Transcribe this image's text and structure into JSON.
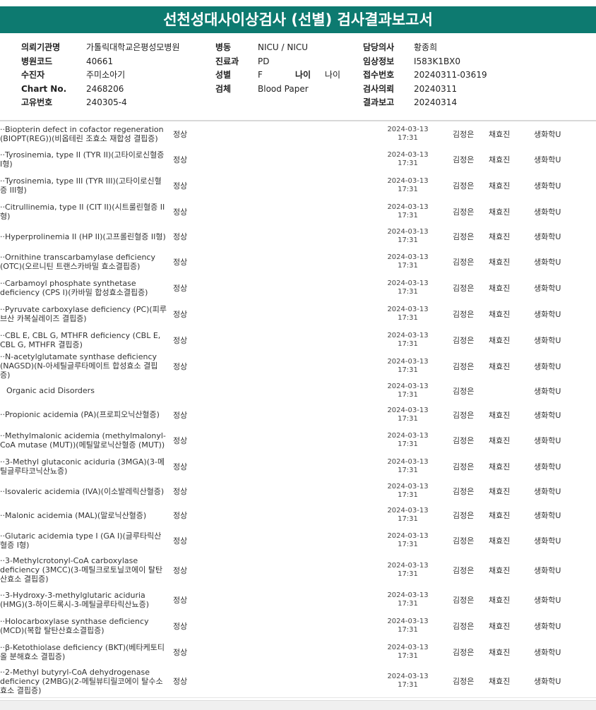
{
  "title": "선천성대사이상검사 (선별) 검사결과보고서",
  "header": {
    "col1": [
      {
        "label": "의뢰기관명",
        "value": "가톨릭대학교은평성모병원"
      },
      {
        "label": "병원코드",
        "value": "40661"
      },
      {
        "label": "수진자",
        "value": "주미소아기"
      },
      {
        "label": "Chart No.",
        "value": "2468206"
      },
      {
        "label": "고유번호",
        "value": "240305-4"
      }
    ],
    "col2": [
      {
        "label": "병동",
        "value": "NICU / NICU"
      },
      {
        "label": "진료과",
        "value": "PD"
      },
      {
        "label": "성별",
        "value": "F"
      },
      {
        "label": "검체",
        "value": "Blood Paper"
      }
    ],
    "age": {
      "label": "나이",
      "value": "나이"
    },
    "col3": [
      {
        "label": "담당의사",
        "value": "황종희"
      },
      {
        "label": "임상정보",
        "value": "I583K1BX0"
      },
      {
        "label": "접수번호",
        "value": "20240311-03619"
      },
      {
        "label": "검사의뢰",
        "value": "20240311"
      },
      {
        "label": "결과보고",
        "value": "20240314"
      }
    ]
  },
  "rows": [
    {
      "name": "··Biopterin defect in cofactor regeneration (BIOPT(REG))(비옵테린 조효소 재합성 결핍증)",
      "result": "정상",
      "date": "2024-03-13",
      "time": "17:31",
      "p1": "김정은",
      "p2": "채효진",
      "dept": "생화학U"
    },
    {
      "name": "··Tyrosinemia, type II (TYR II)(고타이로신혈증 I형)",
      "result": "정상",
      "date": "2024-03-13",
      "time": "17:31",
      "p1": "김정은",
      "p2": "채효진",
      "dept": "생화학U"
    },
    {
      "name": "··Tyrosinemia, type III (TYR III)(고타이로신혈증 III형)",
      "result": "정상",
      "date": "2024-03-13",
      "time": "17:31",
      "p1": "김정은",
      "p2": "채효진",
      "dept": "생화학U"
    },
    {
      "name": "··Citrullinemia, type II (CIT II)(시트룰린혈증 II 형)",
      "result": "정상",
      "date": "2024-03-13",
      "time": "17:31",
      "p1": "김정은",
      "p2": "채효진",
      "dept": "생화학U"
    },
    {
      "name": "··Hyperprolinemia II (HP II)(고프롤린혈증 II형)",
      "result": "정상",
      "date": "2024-03-13",
      "time": "17:31",
      "p1": "김정은",
      "p2": "채효진",
      "dept": "생화학U"
    },
    {
      "name": "··Ornithine transcarbamylase deficiency (OTC)(오르니틴 트랜스카바밀 효소결핍증)",
      "result": "정상",
      "date": "2024-03-13",
      "time": "17:31",
      "p1": "김정은",
      "p2": "채효진",
      "dept": "생화학U"
    },
    {
      "name": "··Carbamoyl phosphate synthetase deficiency (CPS I)(카바밀 합성효소결핍증)",
      "result": "정상",
      "date": "2024-03-13",
      "time": "17:31",
      "p1": "김정은",
      "p2": "채효진",
      "dept": "생화학U"
    },
    {
      "name": "··Pyruvate carboxylase deficiency (PC)(피루브산 카복실레이즈 결핍증)",
      "result": "정상",
      "date": "2024-03-13",
      "time": "17:31",
      "p1": "김정은",
      "p2": "채효진",
      "dept": "생화학U"
    },
    {
      "name": "··CBL E, CBL G, MTHFR deficiency (CBL E, CBL G, MTHFR 결핍증)",
      "result": "정상",
      "date": "2024-03-13",
      "time": "17:31",
      "p1": "김정은",
      "p2": "채효진",
      "dept": "생화학U"
    },
    {
      "name": "··N-acetylglutamate synthase deficiency (NAGSD)(N-아세틸글루타메이트 합성효소 결핍증)",
      "result": "정상",
      "date": "2024-03-13",
      "time": "17:31",
      "p1": "김정은",
      "p2": "채효진",
      "dept": "생화학U"
    },
    {
      "name": "Organic acid Disorders",
      "result": "",
      "date": "2024-03-13",
      "time": "17:31",
      "p1": "김정은",
      "p2": "",
      "dept": "생화학U",
      "section": true
    },
    {
      "name": "··Propionic acidemia (PA)(프로피오닉산혈증)",
      "result": "정상",
      "date": "2024-03-13",
      "time": "17:31",
      "p1": "김정은",
      "p2": "채효진",
      "dept": "생화학U"
    },
    {
      "name": "··Methylmalonic acidemia (methylmalonyl-CoA mutase (MUT))(메틸말로닉산혈증 (MUT))",
      "result": "정상",
      "date": "2024-03-13",
      "time": "17:31",
      "p1": "김정은",
      "p2": "채효진",
      "dept": "생화학U"
    },
    {
      "name": "··3-Methyl glutaconic aciduria (3MGA)(3-메틸글루타코닉산뇨증)",
      "result": "정상",
      "date": "2024-03-13",
      "time": "17:31",
      "p1": "김정은",
      "p2": "채효진",
      "dept": "생화학U"
    },
    {
      "name": "··Isovaleric acidemia (IVA)(이소발레릭산혈증)",
      "result": "정상",
      "date": "2024-03-13",
      "time": "17:31",
      "p1": "김정은",
      "p2": "채효진",
      "dept": "생화학U"
    },
    {
      "name": "··Malonic acidemia (MAL)(말로닉산혈증)",
      "result": "정상",
      "date": "2024-03-13",
      "time": "17:31",
      "p1": "김정은",
      "p2": "채효진",
      "dept": "생화학U"
    },
    {
      "name": "··Glutaric acidemia type I (GA I)(글루타릭산혈증 I형)",
      "result": "정상",
      "date": "2024-03-13",
      "time": "17:31",
      "p1": "김정은",
      "p2": "채효진",
      "dept": "생화학U"
    },
    {
      "name": "··3-Methylcrotonyl-CoA carboxylase deficiency (3MCC)(3-메틸크로토닐코에이 탈탄산효소 결핍증)",
      "result": "정상",
      "date": "2024-03-13",
      "time": "17:31",
      "p1": "김정은",
      "p2": "채효진",
      "dept": "생화학U"
    },
    {
      "name": "··3-Hydroxy-3-methylglutaric aciduria (HMG)(3-하이드록시-3-메틸글루타릭산뇨증)",
      "result": "정상",
      "date": "2024-03-13",
      "time": "17:31",
      "p1": "김정은",
      "p2": "채효진",
      "dept": "생화학U"
    },
    {
      "name": "··Holocarboxylase synthase deficiency (MCD)(복합 탈탄산효소결핍증)",
      "result": "정상",
      "date": "2024-03-13",
      "time": "17:31",
      "p1": "김정은",
      "p2": "채효진",
      "dept": "생화학U"
    },
    {
      "name": "··β-Ketothiolase deficiency (BKT)(베타케토티올 분해효소 결핍증)",
      "result": "정상",
      "date": "2024-03-13",
      "time": "17:31",
      "p1": "김정은",
      "p2": "채효진",
      "dept": "생화학U"
    },
    {
      "name": "··2-Methyl butyryl-CoA dehydrogenase deficiency (2MBG)(2-메틸뷰티릴코에이 탈수소효소 결핍증)",
      "result": "정상",
      "date": "2024-03-13",
      "time": "17:31",
      "p1": "김정은",
      "p2": "채효진",
      "dept": "생화학U"
    }
  ]
}
